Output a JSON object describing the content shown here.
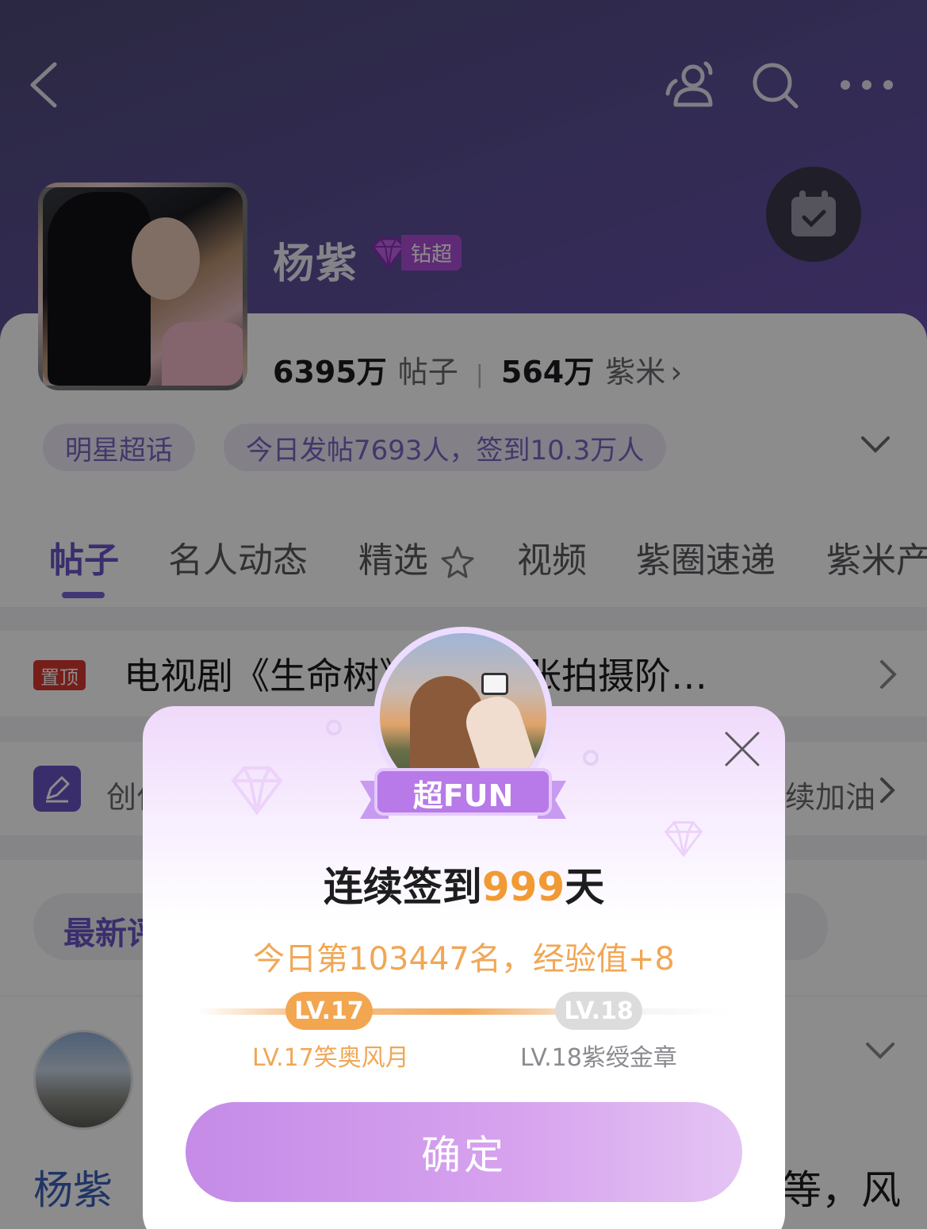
{
  "header": {
    "back_icon": "chevron-left-icon",
    "actions": [
      "people-icon",
      "search-icon",
      "more-icon"
    ]
  },
  "profile": {
    "name": "杨紫",
    "badge": "钻超",
    "posts_count": "6395万",
    "posts_label": "帖子",
    "fans_count": "564万",
    "fans_label": "紫米",
    "fans_chevron": "›",
    "tag": "明星超话",
    "today_stats": "今日发帖7693人，签到10.3万人"
  },
  "tabs": [
    "帖子",
    "名人动态",
    "精选",
    "视频",
    "紫圈速递",
    "紫米产"
  ],
  "pinned": {
    "badge": "置顶",
    "text": "电视剧《生命树》处于紧张拍摄阶…"
  },
  "create_row": {
    "left_text": "创作",
    "right_text": "续加油"
  },
  "filter": {
    "label": "最新评"
  },
  "post": {
    "title": "杨紫",
    "right_text": "等，风"
  },
  "dialog": {
    "ribbon": "超FUN",
    "title_prefix": "连续签到",
    "title_days": "999",
    "title_suffix": "天",
    "subtitle": "今日第103447名，经验值+8",
    "current_level": "LV.17",
    "next_level": "LV.18",
    "current_level_name": "LV.17笑奥风月",
    "next_level_name": "LV.18紫绶金章",
    "confirm": "确定"
  },
  "colors": {
    "accent": "#6b55c8",
    "highlight": "#f19a33",
    "confirm_gradient_start": "#c58be8",
    "pin_badge": "#d8382f"
  }
}
